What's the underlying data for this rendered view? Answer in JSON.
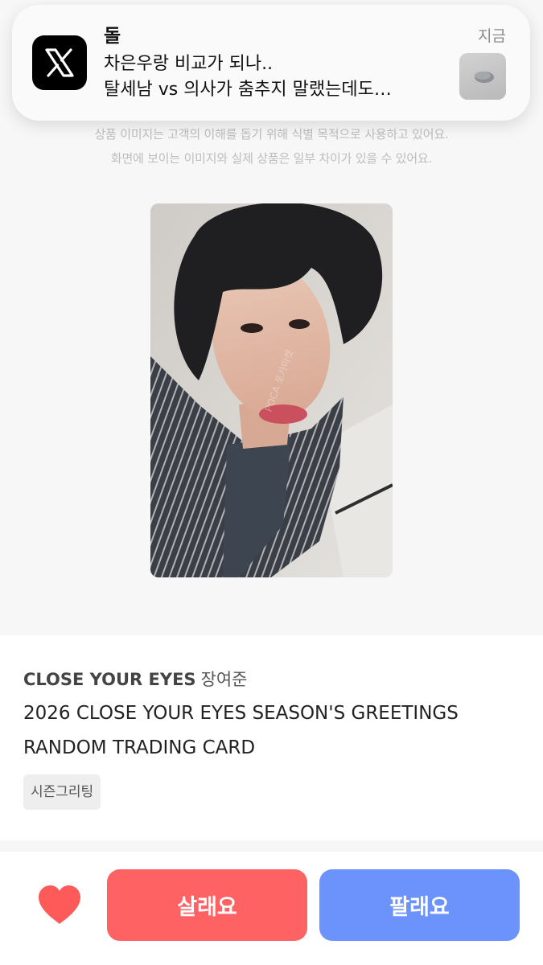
{
  "notification": {
    "app_icon": "x-logo-icon",
    "sender": "돌",
    "line1": "차은우랑 비교가 되나..",
    "line2": "탈세남 vs 의사가 춤추지 말랬는데도…",
    "time": "지금",
    "thumbnail": "attachment-thumbnail"
  },
  "image_notice": {
    "line1": "상품 이미지는 고객의 이해를 돕기 위해 식별 목적으로 사용하고 있어요.",
    "line2": "화면에 보이는 이미지와 실제 상품은 일부 차이가 있을 수 있어요."
  },
  "product": {
    "artist": "CLOSE YOUR EYES",
    "member": "장여준",
    "title": "2026 CLOSE YOUR EYES SEASON'S GREETINGS RANDOM TRADING CARD",
    "tag": "시즌그리팅",
    "image": "photocard-image"
  },
  "actions": {
    "favorite_icon": "heart-icon",
    "buy_label": "살래요",
    "sell_label": "팔래요"
  },
  "colors": {
    "buy": "#ff6262",
    "sell": "#6b93fb",
    "heart": "#ff5a5a"
  }
}
